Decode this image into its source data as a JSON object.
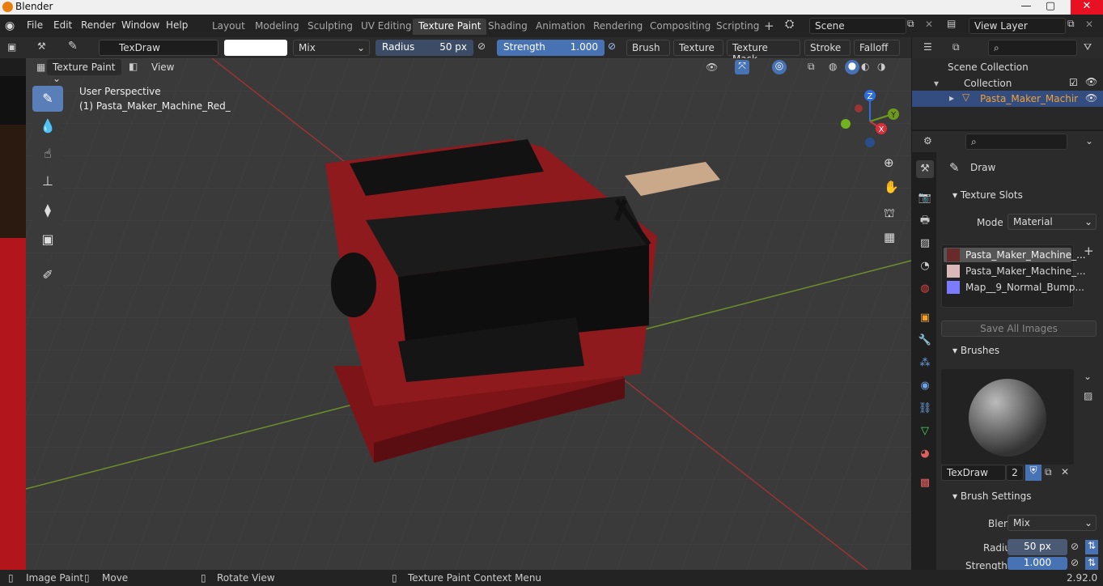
{
  "window": {
    "title": "Blender",
    "min": "—",
    "max": "▢",
    "close": "✕"
  },
  "menubar": {
    "items": [
      "File",
      "Edit",
      "Render",
      "Window",
      "Help"
    ]
  },
  "workspaces": [
    "Layout",
    "Modeling",
    "Sculpting",
    "UV Editing",
    "Texture Paint",
    "Shading",
    "Animation",
    "Rendering",
    "Compositing",
    "Scripting"
  ],
  "workspace_add": "+",
  "scene": {
    "label": "Scene",
    "view_layer": "View Layer"
  },
  "tool_header": {
    "brush_name": "TexDraw",
    "blend": "Mix",
    "radius_label": "Radius",
    "radius_value": "50 px",
    "strength_label": "Strength",
    "strength_value": "1.000",
    "menus": [
      "Brush",
      "Texture",
      "Texture Mask",
      "Stroke",
      "Falloff"
    ]
  },
  "viewport_header": {
    "mode": "Texture Paint",
    "view": "View"
  },
  "viewport": {
    "perspective": "User Perspective",
    "object": "(1) Pasta_Maker_Machine_Red_"
  },
  "gizmo": {
    "z": "Z",
    "y": "Y",
    "x": "X"
  },
  "outliner": {
    "scene_collection": "Scene Collection",
    "collection": "Collection",
    "object": "Pasta_Maker_Machir"
  },
  "properties": {
    "tool": "Draw",
    "texture_slots": {
      "title": "Texture Slots",
      "mode_label": "Mode",
      "mode_value": "Material",
      "slots": [
        "Pasta_Maker_Machine_...",
        "Pasta_Maker_Machine_...",
        "Map__9_Normal_Bump..."
      ],
      "save_button": "Save All Images"
    },
    "brushes": {
      "title": "Brushes",
      "name": "TexDraw",
      "users": "2"
    },
    "brush_settings": {
      "title": "Brush Settings",
      "blend_label": "Blend",
      "blend_value": "Mix",
      "radius_label": "Radius",
      "radius_value": "50 px",
      "strength_label": "Strength",
      "strength_value": "1.000"
    }
  },
  "statusbar": {
    "image_paint": "Image Paint",
    "move": "Move",
    "rotate": "Rotate View",
    "context": "Texture Paint Context Menu",
    "version": "2.92.0"
  },
  "colors": {
    "accent": "#4772b3",
    "machine_red": "#8e1a1e",
    "handle_wood": "#c9a98a"
  }
}
